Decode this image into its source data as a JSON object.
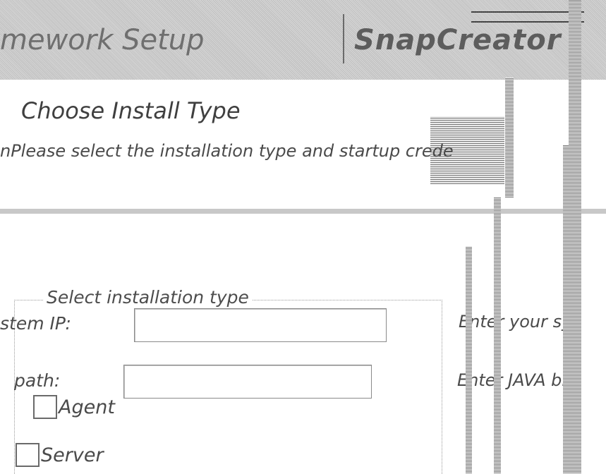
{
  "window": {
    "title": "mework Setup"
  },
  "brand": {
    "name": "SnapCreator"
  },
  "page": {
    "heading": "Choose Install Type",
    "subheading": "nPlease select the installation type and startup crede"
  },
  "install_type": {
    "group_label": "Select installation type",
    "options": [
      {
        "label": "Agent",
        "checked": false
      },
      {
        "label": "Server",
        "checked": false
      }
    ]
  },
  "fields": {
    "system_ip": {
      "label": "stem IP:",
      "value": "",
      "hint": "Enter your sy"
    },
    "java_path": {
      "label": "path:",
      "value": "",
      "hint": "Enter JAVA bin"
    }
  }
}
